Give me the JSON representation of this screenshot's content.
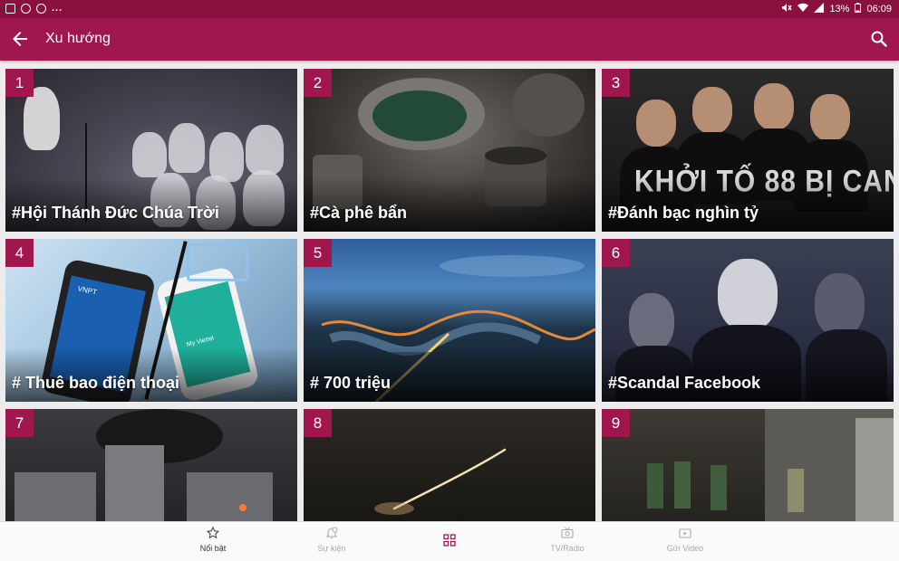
{
  "status_bar": {
    "battery": "13%",
    "time": "06:09"
  },
  "app_bar": {
    "title": "Xu hướng"
  },
  "trends": [
    {
      "rank": "1",
      "tag": "#Hội Thánh Đức Chúa Trời"
    },
    {
      "rank": "2",
      "tag": "#Cà phê bẩn"
    },
    {
      "rank": "3",
      "tag": "#Đánh bạc nghìn tỷ",
      "image_text": "KHỞI TỐ 88 BỊ CAN"
    },
    {
      "rank": "4",
      "tag": "# Thuê bao điện thoại",
      "image_text": [
        "VNPT",
        "My Viettel"
      ]
    },
    {
      "rank": "5",
      "tag": "# 700 triệu"
    },
    {
      "rank": "6",
      "tag": "#Scandal Facebook"
    },
    {
      "rank": "7",
      "tag": ""
    },
    {
      "rank": "8",
      "tag": ""
    },
    {
      "rank": "9",
      "tag": ""
    }
  ],
  "bottom_nav": [
    {
      "label": "Nổi bật",
      "icon": "star-icon",
      "active": true
    },
    {
      "label": "Sự kiện",
      "icon": "bell-clock-icon",
      "active": false
    },
    {
      "label": "",
      "icon": "grid-icon",
      "active": false
    },
    {
      "label": "TV/Radio",
      "icon": "tv-icon",
      "active": false
    },
    {
      "label": "Gửi Video",
      "icon": "video-upload-icon",
      "active": false
    }
  ],
  "colors": {
    "primary": "#a0174d",
    "status_bar": "#8a1040",
    "background": "#ececec"
  }
}
